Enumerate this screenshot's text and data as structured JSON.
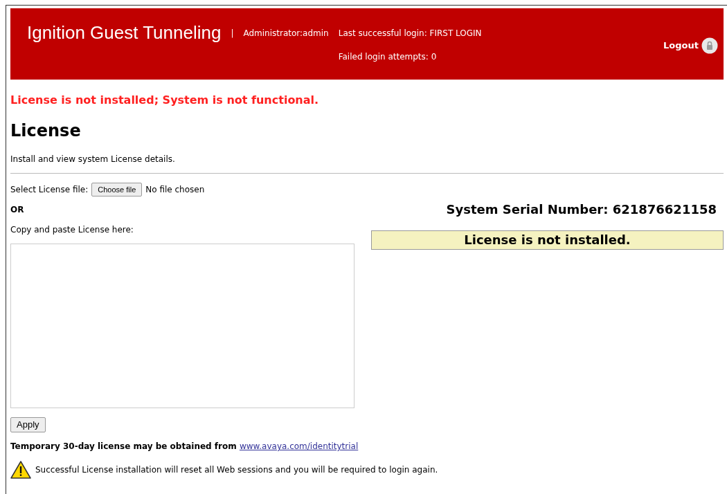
{
  "header": {
    "title": "Ignition Guest Tunneling",
    "separator": "|",
    "user": "Administrator:admin",
    "last_login": "Last successful login: FIRST LOGIN",
    "failed_attempts": "Failed login attempts: 0",
    "logout": "Logout"
  },
  "alert": "License is not installed; System is not functional.",
  "page": {
    "title": "License",
    "description": "Install and view system License details."
  },
  "file_select": {
    "label": "Select License file:",
    "button": "Choose file",
    "status": "No file chosen"
  },
  "or_label": "OR",
  "paste_label": "Copy and paste License here:",
  "serial": "System Serial Number: 621876621158",
  "license_status": "License is not installed.",
  "apply": "Apply",
  "trial_note": {
    "text": "Temporary 30-day license may be obtained from",
    "link": "www.avaya.com/identitytrial"
  },
  "warning": "Successful License installation will reset all Web sessions and you will be required to login again."
}
